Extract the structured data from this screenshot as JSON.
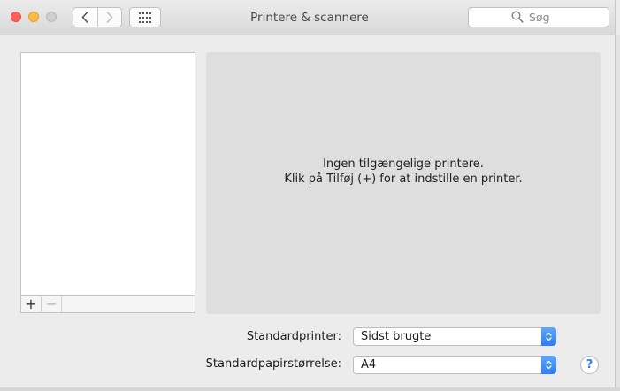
{
  "window": {
    "title": "Printere & scannere"
  },
  "search": {
    "placeholder": "Søg"
  },
  "printer_list": {
    "add_label": "+",
    "remove_label": "−"
  },
  "info": {
    "line1": "Ingen tilgængelige printere.",
    "line2": "Klik på Tilføj (+) for at indstille en printer."
  },
  "settings": {
    "default_printer_label": "Standardprinter:",
    "default_printer_value": "Sidst brugte",
    "paper_size_label": "Standardpapirstørrelse:",
    "paper_size_value": "A4"
  },
  "help": {
    "label": "?"
  },
  "colors": {
    "accent": "#2c7cf5",
    "close": "#fc605c",
    "minimize": "#fdbc40",
    "zoom_disabled": "#cfcfcf"
  }
}
